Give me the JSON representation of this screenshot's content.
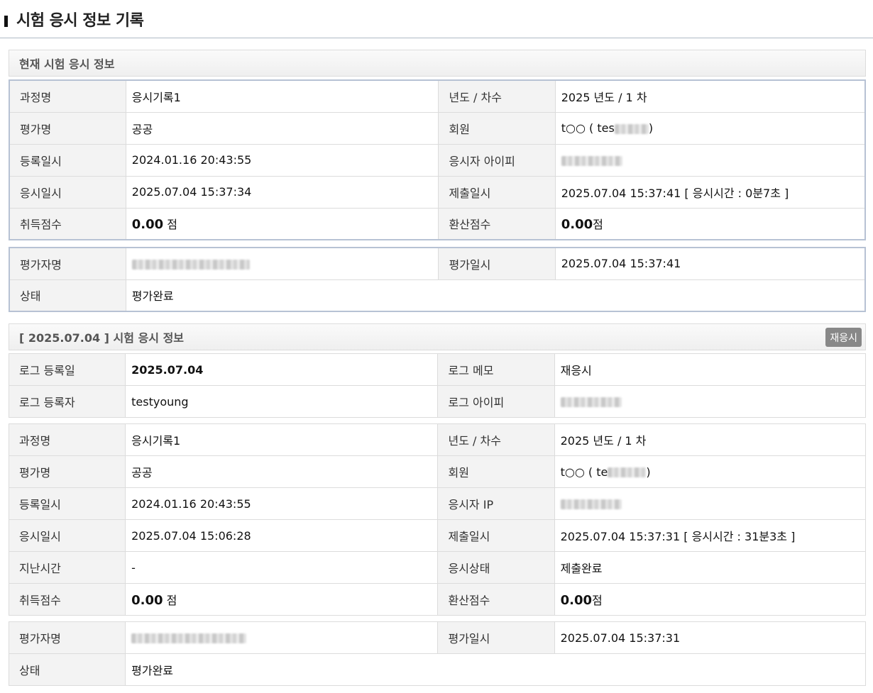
{
  "page_title": "시험 응시 정보 기록",
  "current": {
    "title": "현재 시험 응시 정보",
    "rows": [
      {
        "l1": "과정명",
        "v1": "응시기록1",
        "l2": "년도 / 차수",
        "v2": "2025 년도 / 1 차"
      },
      {
        "l1": "평가명",
        "v1": "공공",
        "l2": "회원",
        "v2_prefix": "t○○ ( tes",
        "v2_suffix": ")"
      },
      {
        "l1": "등록일시",
        "v1": "2024.01.16 20:43:55",
        "l2": "응시자 아이피"
      },
      {
        "l1": "응시일시",
        "v1": "2025.07.04 15:37:34",
        "l2": "제출일시",
        "v2": "2025.07.04 15:37:41 [ 응시시간 : 0분7초 ]"
      },
      {
        "l1": "취득점수",
        "v1_score": "0.00",
        "v1_unit": " 점",
        "l2": "환산점수",
        "v2_score": "0.00",
        "v2_unit": "점"
      }
    ],
    "eval": {
      "evaluator_label": "평가자명",
      "date_label": "평가일시",
      "date": "2025.07.04 15:37:41",
      "status_label": "상태",
      "status": "평가완료"
    }
  },
  "log": {
    "title": "[ 2025.07.04 ] 시험 응시 정보",
    "retake_button": "재응시",
    "meta": [
      {
        "l1": "로그 등록일",
        "v1": "2025.07.04",
        "l2": "로그 메모",
        "v2": "재응시"
      },
      {
        "l1": "로그 등록자",
        "v1": "testyoung",
        "l2": "로그 아이피"
      }
    ],
    "rows": [
      {
        "l1": "과정명",
        "v1": "응시기록1",
        "l2": "년도 / 차수",
        "v2": "2025 년도 / 1 차"
      },
      {
        "l1": "평가명",
        "v1": "공공",
        "l2": "회원",
        "v2_prefix": "t○○ ( te",
        "v2_suffix": ")"
      },
      {
        "l1": "등록일시",
        "v1": "2024.01.16 20:43:55",
        "l2": "응시자 IP"
      },
      {
        "l1": "응시일시",
        "v1": "2025.07.04 15:06:28",
        "l2": "제출일시",
        "v2": "2025.07.04 15:37:31 [ 응시시간 : 31분3초 ]"
      },
      {
        "l1": "지난시간",
        "v1": "-",
        "l2": "응시상태",
        "v2": "제출완료"
      },
      {
        "l1": "취득점수",
        "v1_score": "0.00",
        "v1_unit": " 점",
        "l2": "환산점수",
        "v2_score": "0.00",
        "v2_unit": "점"
      }
    ],
    "eval": {
      "evaluator_label": "평가자명",
      "date_label": "평가일시",
      "date": "2025.07.04 15:37:31",
      "status_label": "상태",
      "status": "평가완료"
    }
  }
}
